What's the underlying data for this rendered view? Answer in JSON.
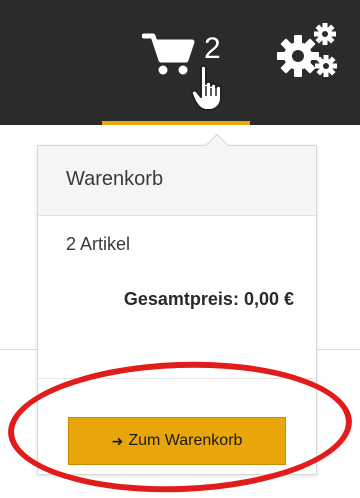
{
  "header": {
    "cart_count": "2",
    "accent_color": "#e8a60a"
  },
  "cart_dropdown": {
    "title": "Warenkorb",
    "item_count_label": "2 Artikel",
    "total_label": "Gesamtpreis: 0,00 €",
    "button_label": "Zum Warenkorb",
    "button_icon": "arrow-right-icon"
  },
  "annotation": {
    "color": "#e21b1b"
  },
  "icons": [
    "shopping-cart-icon",
    "hand-pointer-icon",
    "gears-icon",
    "arrow-right-icon"
  ]
}
